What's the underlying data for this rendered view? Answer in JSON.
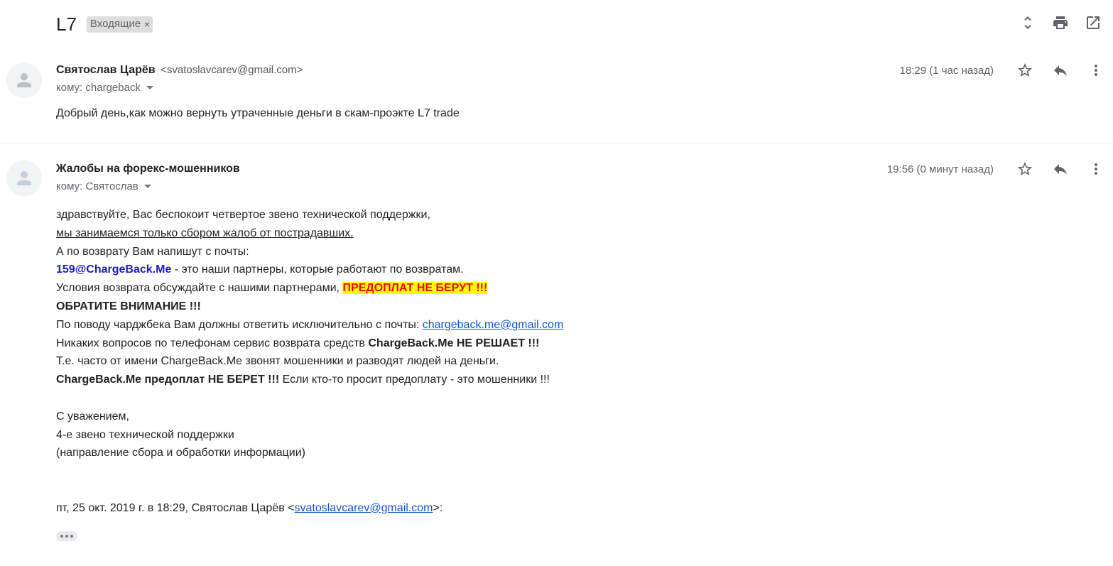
{
  "thread": {
    "subject": "L7",
    "label": "Входящие",
    "label_remove": "×",
    "icons": [
      "expand-collapse-icon",
      "print-icon",
      "open-in-new-window-icon"
    ]
  },
  "messages": [
    {
      "sender_name": "Святослав Царёв",
      "sender_email": "<svatoslavcarev@gmail.com>",
      "to": "кому: chargeback",
      "time": "18:29 (1 час назад)",
      "body": "Добрый день,как можно вернуть утраченные деньги в скам-проэкте L7 trade"
    },
    {
      "sender_name": "Жалобы на форекс-мошенников",
      "to": "кому: Святослав",
      "time": "19:56 (0 минут назад)",
      "body": {
        "l1": "здравствуйте, Вас беспокоит четвертое звено технической поддержки,",
        "l2": "мы занимаемся только сбором жалоб от пострадавших.",
        "l3": "А по возврату Вам напишут с почты:",
        "l4_email": "159@ChargeBack.Me",
        "l4_rest": " - это наши партнеры, которые работают по возвратам.",
        "l5_pre": "Условия возврата обсуждайте с нашими партнерами, ",
        "l5_highlight": "ПРЕДОПЛАТ НЕ БЕРУТ !!!",
        "l6": "ОБРАТИТЕ ВНИМАНИЕ !!!",
        "l7_pre": "По поводу чарджбека Вам должны ответить исключительно с почты: ",
        "l7_link": "chargeback.me@gmail.com",
        "l8_pre": "Никаких вопросов по телефонам сервис возврата средств ",
        "l8_bold": "ChargeBack.Me НЕ РЕШАЕТ !!!",
        "l9": "Т.е. часто от имени ChargeBack.Me звонят мошенники и разводят людей на деньги.",
        "l10_bold": "ChargeBack.Me предоплат НЕ БЕРЕТ !!!",
        "l10_rest": " Если кто-то просит предоплату - это мошенники !!!",
        "sig1": "С уважением,",
        "sig2": "4-е звено технической поддержки",
        "sig3": "(направление сбора и обработки информации)",
        "quote_pre": "пт, 25 окт. 2019 г. в 18:29, Святослав Царёв <",
        "quote_link": "svatoslavcarev@gmail.com",
        "quote_post": ">:"
      }
    }
  ]
}
